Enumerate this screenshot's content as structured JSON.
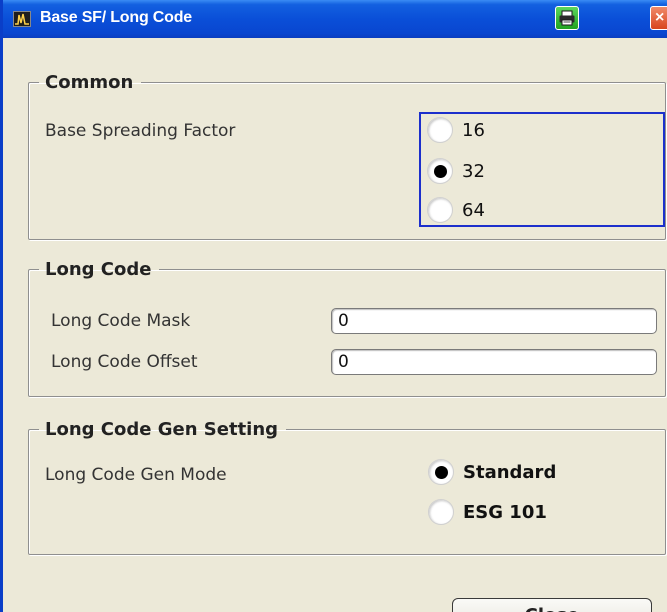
{
  "window": {
    "title": "Base SF/ Long Code",
    "close_glyph": "×"
  },
  "common": {
    "legend": "Common",
    "spreading_factor_label": "Base Spreading Factor",
    "spreading_factor_options": [
      {
        "label": "16",
        "selected": false
      },
      {
        "label": "32",
        "selected": true
      },
      {
        "label": "64",
        "selected": false
      }
    ]
  },
  "long_code": {
    "legend": "Long Code",
    "mask_label": "Long Code Mask",
    "mask_value": "0",
    "offset_label": "Long Code Offset",
    "offset_value": "0"
  },
  "gen_setting": {
    "legend": "Long Code Gen Setting",
    "mode_label": "Long Code Gen Mode",
    "mode_options": [
      {
        "label": "Standard",
        "selected": true
      },
      {
        "label": "ESG 101",
        "selected": false
      }
    ]
  },
  "footer": {
    "close_label": "Close"
  },
  "icons": {
    "app": "spectrum-icon",
    "print": "printer-icon",
    "close": "close-icon"
  },
  "colors": {
    "titlebar": "#0a4fd8",
    "window_bg": "#ece9d8",
    "focus_border": "#1c2fcc",
    "print_button": "#1fa21f",
    "close_button": "#d8451e"
  }
}
